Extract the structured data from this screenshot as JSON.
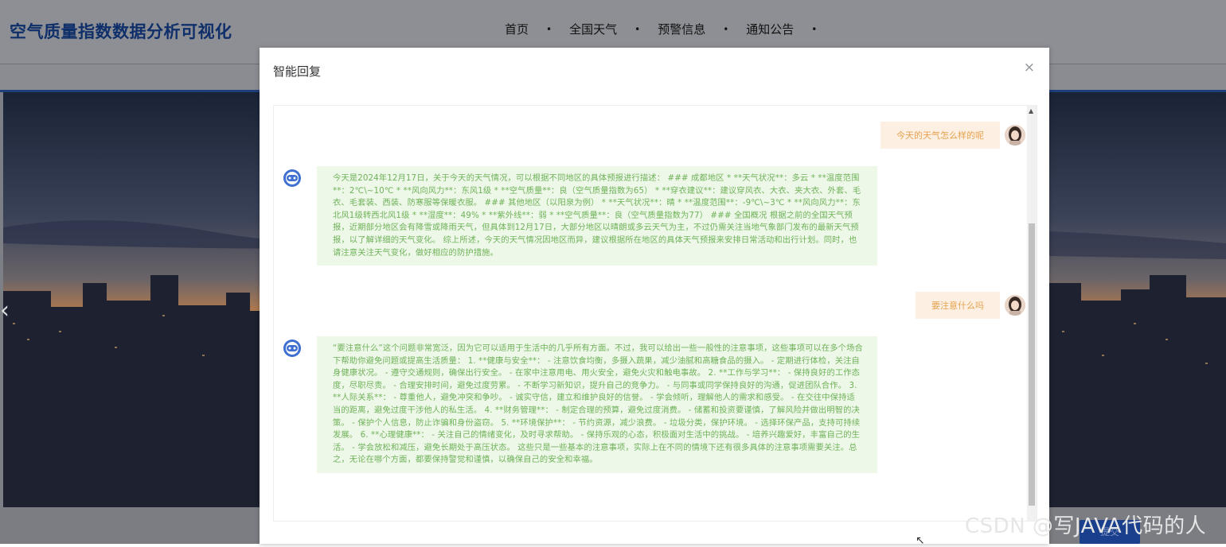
{
  "header": {
    "site_title": "空气质量指数数据分析可视化",
    "nav": [
      "首页",
      "全国天气",
      "预警信息",
      "通知公告"
    ],
    "nav_separator": "•"
  },
  "carousel": {
    "prev_glyph": "‹"
  },
  "bottom_button": {
    "label": "提交"
  },
  "dialog": {
    "title": "智能回复",
    "close_glyph": "×",
    "messages": [
      {
        "role": "user",
        "text": "今天的天气怎么样的呢"
      },
      {
        "role": "bot",
        "text": "今天是2024年12月17日，关于今天的天气情况，可以根据不同地区的具体预报进行描述： ### 成都地区 * **天气状况**：多云 * **温度范围**：2℃\\~10℃ * **风向风力**：东风1级 * **空气质量**：良（空气质量指数为65） * **穿衣建议**：建议穿风衣、大衣、夹大衣、外套、毛衣、毛套装、西装、防寒服等保暖衣服。 ### 其他地区（以阳泉为例） * **天气状况**：晴 * **温度范围**：-9℃\\~3℃ * **风向风力**：东北风1级转西北风1级 * **湿度**：49% * **紫外线**：弱 * **空气质量**：良（空气质量指数为77） ### 全国概况 根据之前的全国天气预报，近期部分地区会有降雪或降雨天气，但具体到12月17日，大部分地区以晴朗或多云天气为主，不过仍需关注当地气象部门发布的最新天气预报，以了解详细的天气变化。 综上所述，今天的天气情况因地区而异，建议根据所在地区的具体天气预报来安排日常活动和出行计划。同时，也请注意关注天气变化，做好相应的防护措施。"
      },
      {
        "role": "user",
        "text": "要注意什么吗"
      },
      {
        "role": "bot",
        "text": "“要注意什么”这个问题非常宽泛，因为它可以适用于生活中的几乎所有方面。不过，我可以给出一些一般性的注意事项，这些事项可以在多个场合下帮助你避免问题或提高生活质量： 1. **健康与安全**： - 注意饮食均衡，多摄入蔬果，减少油腻和高糖食品的摄入。 - 定期进行体检，关注自身健康状况。 - 遵守交通规则，确保出行安全。 - 在家中注意用电、用火安全，避免火灾和触电事故。 2. **工作与学习**： - 保持良好的工作态度，尽职尽责。 - 合理安排时间，避免过度劳累。 - 不断学习新知识，提升自己的竞争力。 - 与同事或同学保持良好的沟通，促进团队合作。 3. **人际关系**： - 尊重他人，避免冲突和争吵。 - 诚实守信，建立和维护良好的信誉。 - 学会倾听，理解他人的需求和感受。 - 在交往中保持适当的距离，避免过度干涉他人的私生活。 4. **财务管理**： - 制定合理的预算，避免过度消费。 - 储蓄和投资要谨慎，了解风险并做出明智的决策。 - 保护个人信息，防止诈骗和身份盗窃。 5. **环境保护**： - 节约资源，减少浪费。 - 垃圾分类，保护环境。 - 选择环保产品，支持可持续发展。 6. **心理健康**： - 关注自己的情绪变化，及时寻求帮助。 - 保持乐观的心态，积极面对生活中的挑战。 - 培养兴趣爱好，丰富自己的生活。 - 学会放松和减压，避免长期处于高压状态。 这些只是一些基本的注意事项，实际上在不同的情境下还有很多具体的注意事项需要关注。总之，无论在哪个方面，都要保持警觉和谨慎，以确保自己的安全和幸福。"
      }
    ]
  },
  "watermark": "CSDN @写JAVA代码的人",
  "colors": {
    "user_bubble_bg": "#fdf0e3",
    "user_bubble_text": "#e5a24f",
    "bot_bubble_bg": "#eef8e8",
    "bot_bubble_text": "#6fb25a",
    "site_title": "#0f2f6a"
  }
}
